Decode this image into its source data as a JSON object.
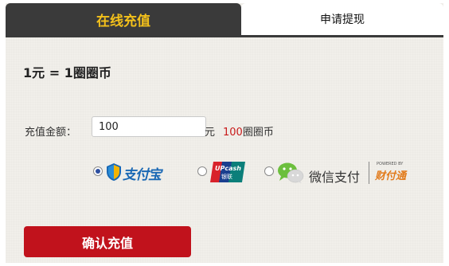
{
  "tabs": {
    "recharge": "在线充值",
    "withdraw": "申请提现"
  },
  "rate_text": "1元 = 1圈圈币",
  "amount": {
    "label": "充值金额：",
    "value": "100",
    "unit": "元",
    "coins_value": "100",
    "coins_unit": "圈圈币"
  },
  "payment": {
    "alipay_logo": "支付宝",
    "unionpay_logo": "UPcash",
    "unionpay_sub": "银联",
    "wechat_label": "微信支付",
    "tenpay_powered": "POWERED BY",
    "tenpay_logo": "财付通",
    "selected": "alipay"
  },
  "confirm_label": "确认充值",
  "colors": {
    "tab_active_bg": "#3a3a3a",
    "tab_active_text": "#f3c01b",
    "confirm_bg": "#c1121c",
    "coins_highlight": "#c81a1a"
  }
}
